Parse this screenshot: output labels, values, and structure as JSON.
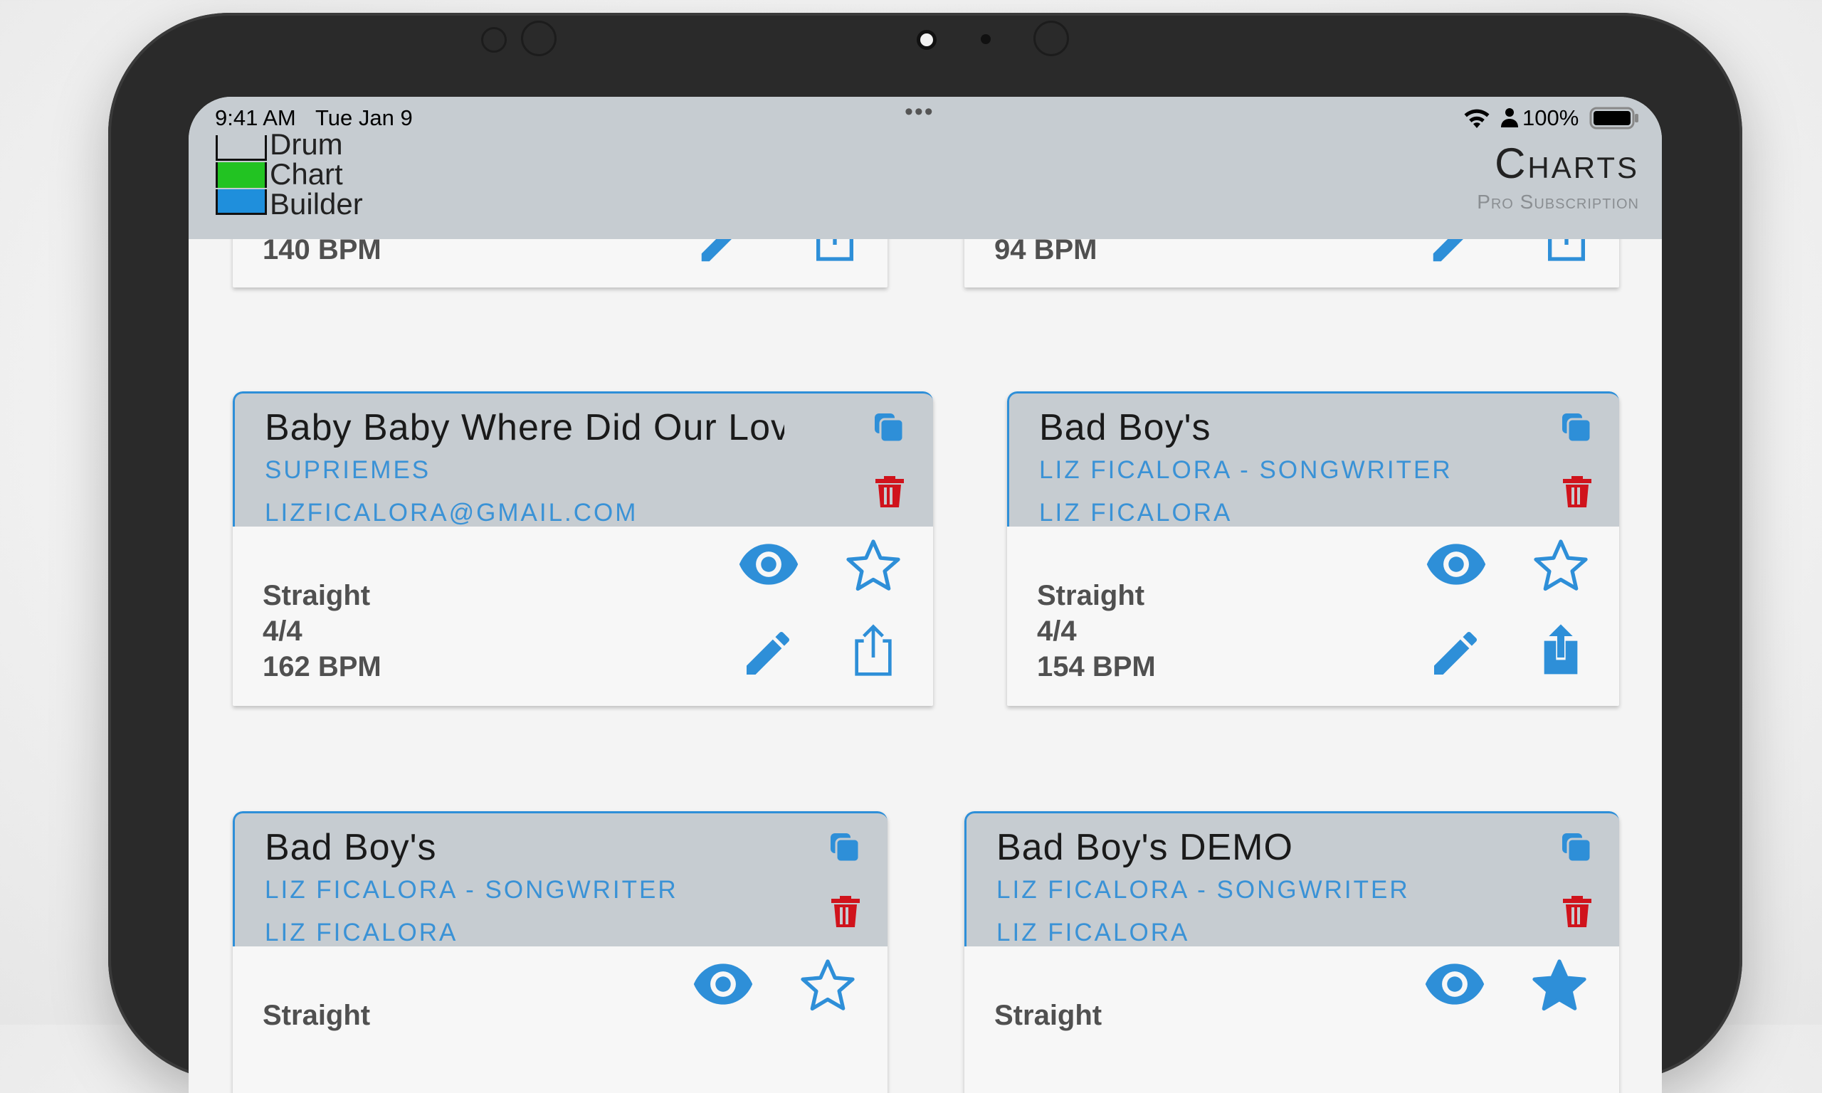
{
  "status_bar": {
    "time": "9:41 AM",
    "date": "Tue Jan 9",
    "battery": "100%",
    "dots": "•••"
  },
  "app": {
    "logo_lines": [
      "Drum",
      "Chart",
      "Builder"
    ],
    "title": "Charts",
    "subtitle": "Pro Subscription",
    "colors": {
      "accent": "#2e8fd8",
      "delete": "#d0131c",
      "header": "#c6ccd1",
      "logo_green": "#22c322",
      "logo_blue": "#1f8fdc"
    }
  },
  "cards": [
    {
      "title": "",
      "line1": "",
      "line2": "",
      "feel": "",
      "meter": "",
      "bpm": "140 BPM",
      "favorite": false,
      "shared": false
    },
    {
      "title": "",
      "line1": "",
      "line2": "",
      "feel": "",
      "meter": "",
      "bpm": "94 BPM",
      "favorite": false,
      "shared": false
    },
    {
      "title": "Baby Baby Where Did Our Lov",
      "line1": "SUPRIEMES",
      "line2": "LIZFICALORA@GMAIL.COM",
      "feel": "Straight",
      "meter": "4/4",
      "bpm": "162 BPM",
      "favorite": false,
      "shared": false
    },
    {
      "title": "Bad Boy's",
      "line1": "LIZ FICALORA - SONGWRITER",
      "line2": "LIZ FICALORA",
      "feel": "Straight",
      "meter": "4/4",
      "bpm": "154 BPM",
      "favorite": false,
      "shared": true
    },
    {
      "title": "Bad Boy's",
      "line1": "LIZ FICALORA - SONGWRITER",
      "line2": "LIZ FICALORA",
      "feel": "Straight",
      "meter": "",
      "bpm": "",
      "favorite": false,
      "shared": false
    },
    {
      "title": "Bad Boy's DEMO",
      "line1": "LIZ FICALORA - SONGWRITER",
      "line2": "LIZ FICALORA",
      "feel": "Straight",
      "meter": "",
      "bpm": "",
      "favorite": true,
      "shared": false
    }
  ]
}
